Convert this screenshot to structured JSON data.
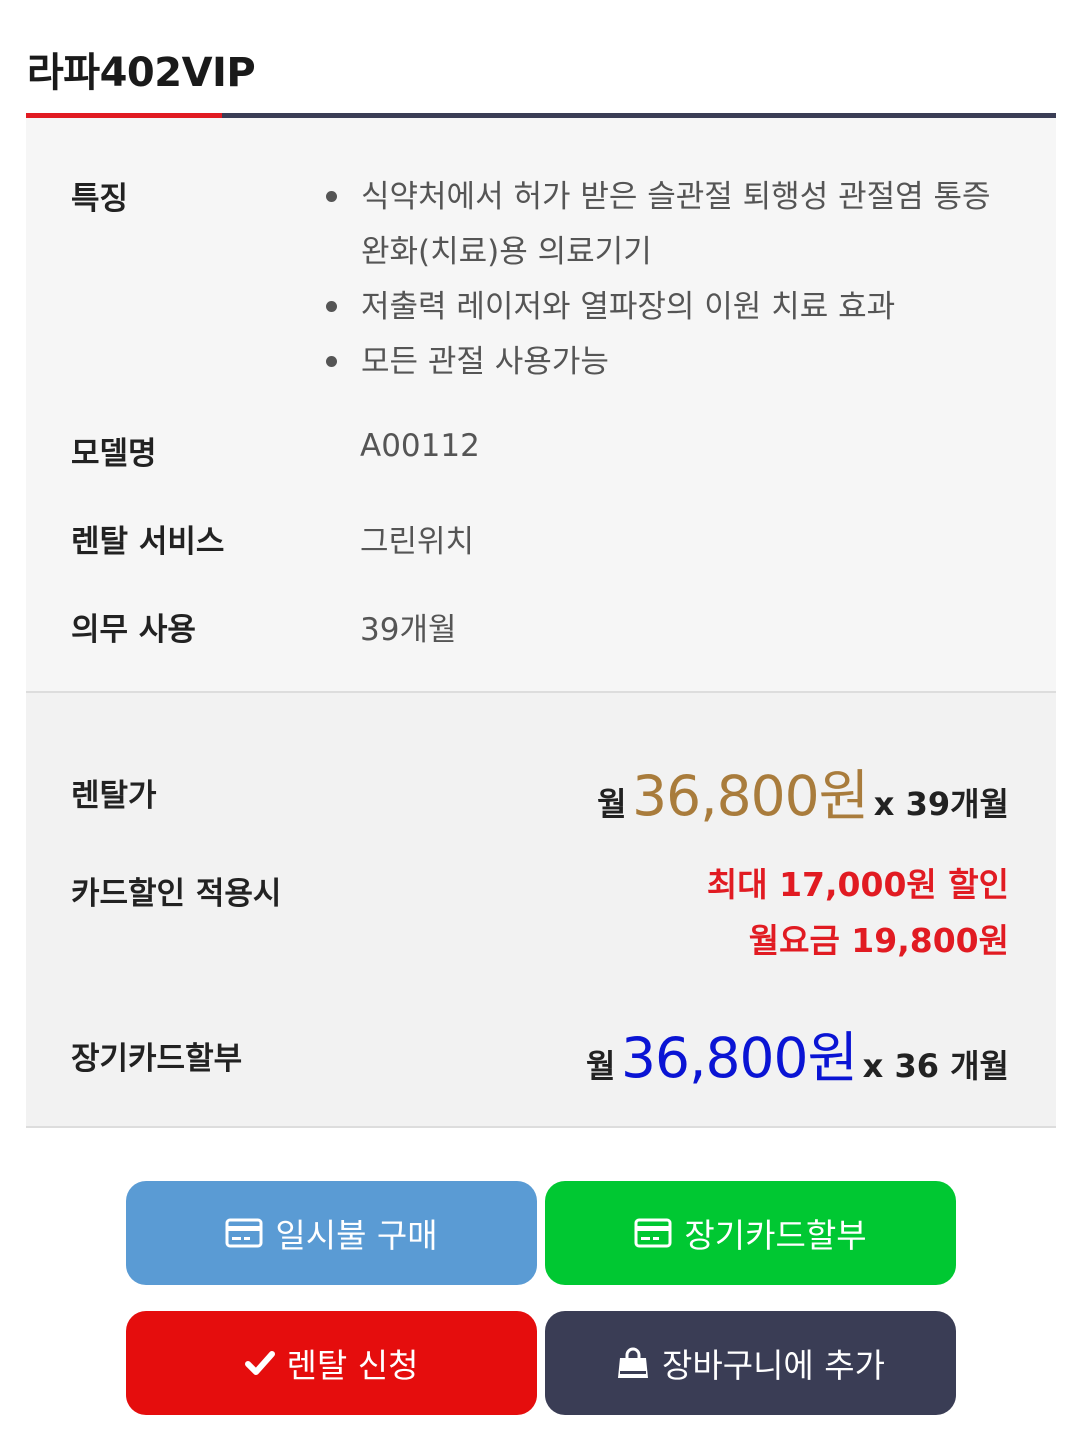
{
  "product": {
    "title": "라파402VIP"
  },
  "info": {
    "features_label": "특징",
    "features": [
      "식약처에서 허가 받은 슬관절 퇴행성 관절염 통증 완화(치료)용 의료기기",
      "저출력 레이저와 열파장의 이원 치료 효과",
      "모든 관절 사용가능"
    ],
    "model_label": "모델명",
    "model_value": "A00112",
    "service_label": "렌탈 서비스",
    "service_value": "그린위치",
    "duty_label": "의무 사용",
    "duty_value": "39개월"
  },
  "pricing": {
    "rental_label": "렌탈가",
    "rental_prefix": "월",
    "rental_amount": "36,800원",
    "rental_suffix": "x 39개월",
    "card_label": "카드할인 적용시",
    "card_discount": "최대 17,000원 할인",
    "card_monthly": "월요금 19,800원",
    "installment_label": "장기카드할부",
    "installment_prefix": "월",
    "installment_amount": "36,800원",
    "installment_suffix": "x 36 개월"
  },
  "buttons": {
    "lump_sum": "일시불 구매",
    "installment": "장기카드할부",
    "rental": "렌탈 신청",
    "cart": "장바구니에 추가"
  },
  "colors": {
    "accent_red": "#e11b22",
    "navy": "#3a3d55",
    "gold_price": "#a97c3c",
    "blue_price": "#0a14d4",
    "lump_button": "#5a9bd4",
    "installment_button": "#00c832",
    "rental_button": "#e50d0d",
    "cart_button": "#3a3d55"
  },
  "icons": {
    "lump_sum": "credit-card-icon",
    "installment": "credit-card-icon",
    "rental": "check-icon",
    "cart": "shopping-bag-icon"
  }
}
